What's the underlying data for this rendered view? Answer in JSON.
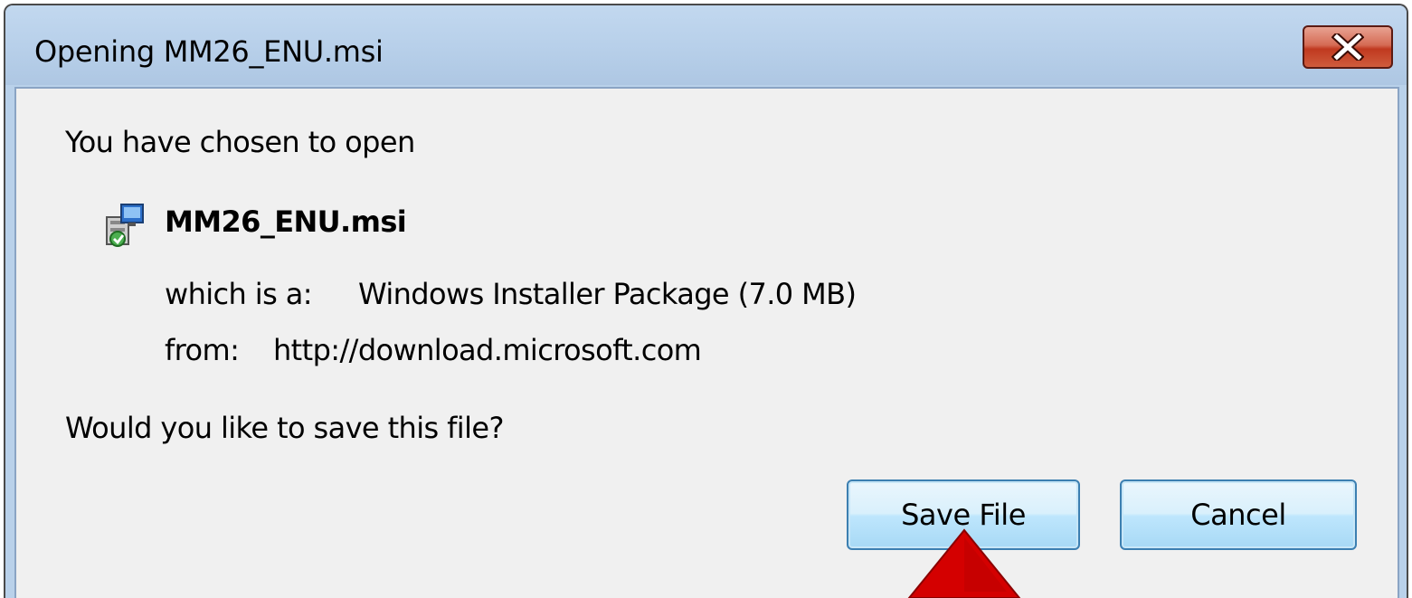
{
  "window": {
    "title": "Opening MM26_ENU.msi"
  },
  "dialog": {
    "intro": "You have chosen to open",
    "file_name": "MM26_ENU.msi",
    "type_label": "which is a:",
    "type_value": "Windows Installer Package (7.0 MB)",
    "from_label": "from:",
    "from_value": "http://download.microsoft.com",
    "question": "Would you like to save this file?"
  },
  "buttons": {
    "save_label": "Save File",
    "cancel_label": "Cancel"
  },
  "icons": {
    "close": "close-icon",
    "file": "installer-package-icon",
    "pointer": "red-arrow-up-icon"
  },
  "colors": {
    "titlebar": "#b9d1ea",
    "close_button": "#c7432a",
    "button_border": "#3c7fb1",
    "arrow": "#d40000"
  }
}
